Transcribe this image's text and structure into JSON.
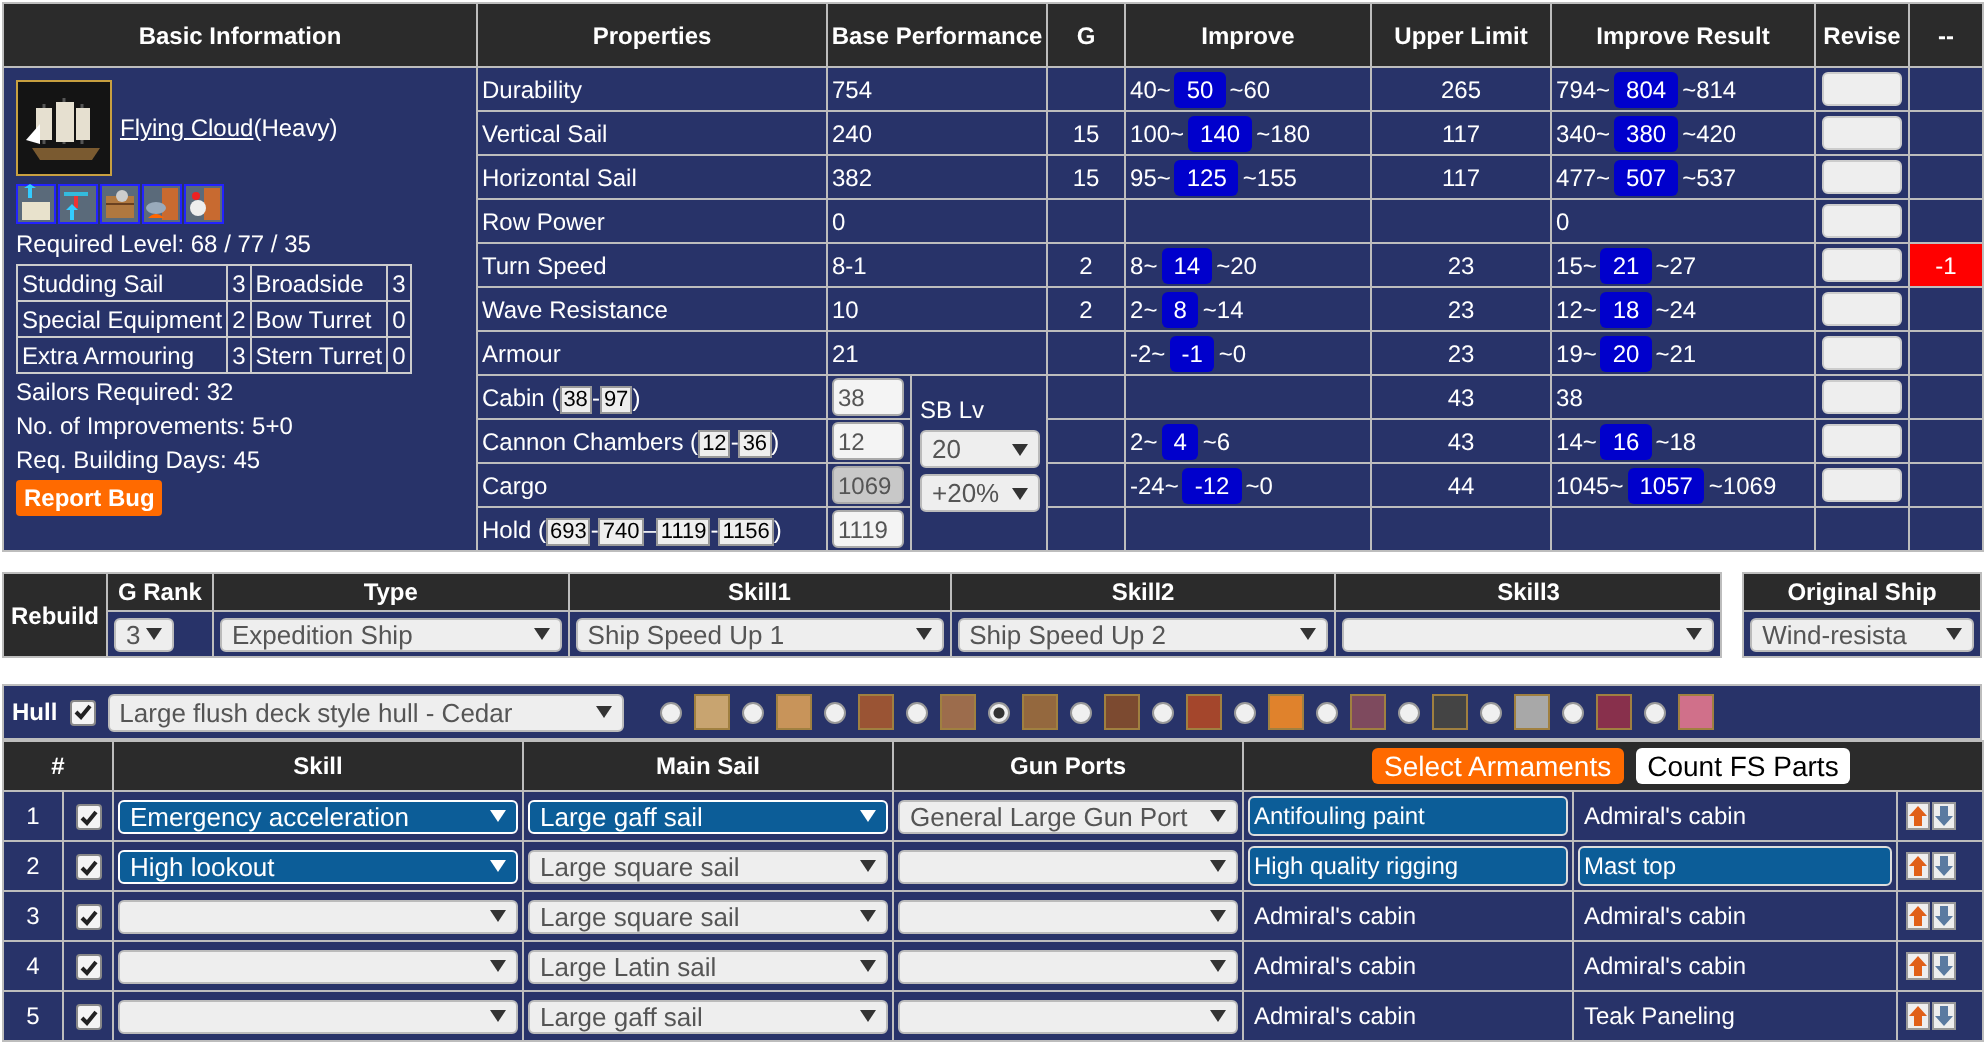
{
  "basic_information": {
    "header": "Basic Information",
    "ship_name": "Flying Cloud",
    "ship_suffix": "(Heavy)",
    "required_level": "Required Level: 68 / 77 / 35",
    "slots": [
      {
        "name": "Studding Sail",
        "count": "3",
        "name_2": "Broadside",
        "count_2": "3"
      },
      {
        "name": "Special Equipment",
        "count": "2",
        "name_2": "Bow Turret",
        "count_2": "0"
      },
      {
        "name": "Extra Armouring",
        "count": "3",
        "name_2": "Stern Turret",
        "count_2": "0"
      }
    ],
    "facts": [
      "Sailors Required: 32",
      "No. of Improvements: 5+0",
      "Req. Building Days: 45"
    ],
    "report_button": "Report Bug"
  },
  "properties": {
    "columns": [
      "Properties",
      "Base Performance",
      "G",
      "Improve",
      "Upper Limit",
      "Improve Result",
      "Revise",
      "--"
    ],
    "rows": [
      {
        "name_parts": [
          {
            "kind": "text",
            "text": "Durability"
          }
        ],
        "base": {
          "kind": "text",
          "text": "754"
        },
        "improve": {
          "low": "40~",
          "mid": "50",
          "high": "~60"
        },
        "upper": "265",
        "result": {
          "low": "794~",
          "mid": "804",
          "high": "~814"
        },
        "revise_field": true
      },
      {
        "name_parts": [
          {
            "kind": "text",
            "text": "Vertical Sail"
          }
        ],
        "base": {
          "kind": "text",
          "text": "240"
        },
        "g": "15",
        "improve": {
          "low": "100~",
          "mid": "140",
          "high": "~180"
        },
        "upper": "117",
        "result": {
          "low": "340~",
          "mid": "380",
          "high": "~420"
        },
        "revise_field": true
      },
      {
        "name_parts": [
          {
            "kind": "text",
            "text": "Horizontal Sail"
          }
        ],
        "base": {
          "kind": "text",
          "text": "382"
        },
        "g": "15",
        "improve": {
          "low": "95~",
          "mid": "125",
          "high": "~155"
        },
        "upper": "117",
        "result": {
          "low": "477~",
          "mid": "507",
          "high": "~537"
        },
        "revise_field": true
      },
      {
        "name_parts": [
          {
            "kind": "text",
            "text": "Row Power"
          }
        ],
        "base": {
          "kind": "text",
          "text": "0"
        },
        "result": {
          "value": "0"
        },
        "revise_field": true
      },
      {
        "name_parts": [
          {
            "kind": "text",
            "text": "Turn Speed"
          }
        ],
        "base": {
          "kind": "text",
          "text": "8-1"
        },
        "g": "2",
        "improve": {
          "low": "8~",
          "mid": "14",
          "high": "~20"
        },
        "upper": "23",
        "result": {
          "low": "15~",
          "mid": "21",
          "high": "~27"
        },
        "revise_field": true,
        "adjustment": "-1"
      },
      {
        "name_parts": [
          {
            "kind": "text",
            "text": "Wave Resistance"
          }
        ],
        "base": {
          "kind": "text",
          "text": "10"
        },
        "g": "2",
        "improve": {
          "low": "2~",
          "mid": "8",
          "high": "~14"
        },
        "upper": "23",
        "result": {
          "low": "12~",
          "mid": "18",
          "high": "~24"
        },
        "revise_field": true
      },
      {
        "name_parts": [
          {
            "kind": "text",
            "text": "Armour"
          }
        ],
        "base": {
          "kind": "text",
          "text": "21"
        },
        "improve": {
          "low": "-2~",
          "mid": "-1",
          "high": "~0"
        },
        "upper": "23",
        "result": {
          "low": "19~",
          "mid": "20",
          "high": "~21"
        },
        "revise_field": true
      },
      {
        "name_parts": [
          {
            "kind": "text",
            "text": "Cabin ("
          },
          {
            "kind": "box",
            "text": "38"
          },
          {
            "kind": "sep",
            "text": "-"
          },
          {
            "kind": "box",
            "text": "97"
          },
          {
            "kind": "sep",
            "text": ")"
          }
        ],
        "base": {
          "kind": "input",
          "value": "38",
          "disabled": false
        },
        "sb": {
          "label": "SB Lv",
          "lv_select": "20",
          "bonus_select": "+20%"
        },
        "upper": "43",
        "result": {
          "value": "38"
        },
        "revise_field": true
      },
      {
        "name_parts": [
          {
            "kind": "text",
            "text": "Cannon Chambers ("
          },
          {
            "kind": "box",
            "text": "12"
          },
          {
            "kind": "sep",
            "text": "-"
          },
          {
            "kind": "box",
            "text": "36"
          },
          {
            "kind": "sep",
            "text": ")"
          }
        ],
        "base": {
          "kind": "input",
          "value": "12",
          "disabled": false
        },
        "improve": {
          "low": "2~",
          "mid": "4",
          "high": "~6"
        },
        "upper": "43",
        "result": {
          "low": "14~",
          "mid": "16",
          "high": "~18"
        },
        "revise_field": true
      },
      {
        "name_parts": [
          {
            "kind": "text",
            "text": "Cargo"
          }
        ],
        "base": {
          "kind": "input",
          "value": "1069",
          "disabled": true
        },
        "improve": {
          "low": "-24~",
          "mid": "-12",
          "high": "~0"
        },
        "upper": "44",
        "result": {
          "low": "1045~",
          "mid": "1057",
          "high": "~1069"
        },
        "revise_field": true
      },
      {
        "name_parts": [
          {
            "kind": "text",
            "text": "Hold ("
          },
          {
            "kind": "box",
            "text": "693"
          },
          {
            "kind": "sep",
            "text": "-"
          },
          {
            "kind": "box",
            "text": "740"
          },
          {
            "kind": "sep",
            "text": "–"
          },
          {
            "kind": "box",
            "text": "1119"
          },
          {
            "kind": "sep",
            "text": "-"
          },
          {
            "kind": "box",
            "text": "1156"
          },
          {
            "kind": "sep",
            "text": ")"
          }
        ],
        "base": {
          "kind": "input",
          "value": "1119",
          "disabled": false
        },
        "revise_field": false
      }
    ]
  },
  "rebuild": {
    "label": "Rebuild",
    "columns": [
      {
        "header": "G Rank",
        "value": "3"
      },
      {
        "header": "Type",
        "value": "Expedition Ship"
      },
      {
        "header": "Skill1",
        "value": "Ship Speed Up 1"
      },
      {
        "header": "Skill2",
        "value": "Ship Speed Up 2"
      },
      {
        "header": "Skill3"
      }
    ],
    "original_ship": {
      "header": "Original Ship",
      "value": "Wind-resista"
    }
  },
  "hull": {
    "label": "Hull",
    "checked": true,
    "select": "Large flush deck style hull - Cedar",
    "materials": [
      {
        "color": "#c8a470",
        "selected": false
      },
      {
        "color": "#c8945a",
        "selected": false
      },
      {
        "color": "#9a5434",
        "selected": false
      },
      {
        "color": "#9c6c4c",
        "selected": false
      },
      {
        "color": "#94683e",
        "selected": true
      },
      {
        "color": "#7c4a30",
        "selected": false
      },
      {
        "color": "#a4462c",
        "selected": false
      },
      {
        "color": "#e0822c",
        "selected": false
      },
      {
        "color": "#7e4a5e",
        "selected": false
      },
      {
        "color": "#444444",
        "selected": false
      },
      {
        "color": "#a8a8a8",
        "selected": false
      },
      {
        "color": "#88304c",
        "selected": false
      },
      {
        "color": "#d0708a",
        "selected": false
      }
    ]
  },
  "parts": {
    "columns": [
      "#",
      "Skill",
      "Main Sail",
      "Gun Ports"
    ],
    "buttons": [
      {
        "kind": "primary",
        "label": "Select Armaments"
      },
      {
        "kind": "secondary",
        "label": "Count FS Parts"
      }
    ],
    "rows": [
      {
        "number": "1",
        "checked": true,
        "skill": {
          "value": "Emergency acceleration",
          "highlighted": true
        },
        "main_sail": {
          "value": "Large gaff sail",
          "highlighted": true
        },
        "gun_port": {
          "value": "General Large Gun Port",
          "highlighted": false
        },
        "part_a": {
          "text": "Antifouling paint",
          "highlighted": true
        },
        "part_b": {
          "text": "Admiral's cabin",
          "highlighted": false
        }
      },
      {
        "number": "2",
        "checked": true,
        "skill": {
          "value": "High lookout",
          "highlighted": true
        },
        "main_sail": {
          "value": "Large square sail",
          "highlighted": false
        },
        "gun_port": {
          "highlighted": false
        },
        "part_a": {
          "text": "High quality rigging",
          "highlighted": true
        },
        "part_b": {
          "text": "Mast top",
          "highlighted": true
        }
      },
      {
        "number": "3",
        "checked": true,
        "skill": {
          "highlighted": false
        },
        "main_sail": {
          "value": "Large square sail",
          "highlighted": false
        },
        "gun_port": {
          "highlighted": false
        },
        "part_a": {
          "text": "Admiral's cabin",
          "highlighted": false
        },
        "part_b": {
          "text": "Admiral's cabin",
          "highlighted": false
        }
      },
      {
        "number": "4",
        "checked": true,
        "skill": {
          "highlighted": false
        },
        "main_sail": {
          "value": "Large Latin sail",
          "highlighted": false
        },
        "gun_port": {
          "highlighted": false
        },
        "part_a": {
          "text": "Admiral's cabin",
          "highlighted": false
        },
        "part_b": {
          "text": "Admiral's cabin",
          "highlighted": false
        }
      },
      {
        "number": "5",
        "checked": true,
        "skill": {
          "highlighted": false
        },
        "main_sail": {
          "value": "Large gaff sail",
          "highlighted": false
        },
        "gun_port": {
          "highlighted": false
        },
        "part_a": {
          "text": "Admiral's cabin",
          "highlighted": false
        },
        "part_b": {
          "text": "Teak Paneling",
          "highlighted": false
        }
      }
    ]
  }
}
